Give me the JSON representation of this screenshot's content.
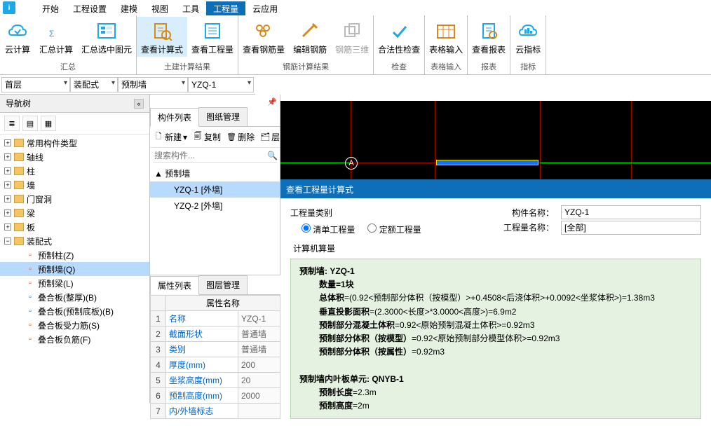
{
  "menubar": [
    "开始",
    "工程设置",
    "建模",
    "视图",
    "工具",
    "工程量",
    "云应用"
  ],
  "menubar_active_index": 5,
  "ribbon": {
    "groups": [
      {
        "label": "汇总",
        "items": [
          {
            "label": "云计算",
            "name": "cloud-calc"
          },
          {
            "label": "汇总计算",
            "name": "sum-calc"
          },
          {
            "label": "汇总选中图元",
            "name": "sum-selected"
          }
        ]
      },
      {
        "label": "土建计算结果",
        "items": [
          {
            "label": "查看计算式",
            "name": "view-formula",
            "active": true
          },
          {
            "label": "查看工程量",
            "name": "view-quantity"
          }
        ]
      },
      {
        "label": "钢筋计算结果",
        "items": [
          {
            "label": "查看钢筋量",
            "name": "view-rebar-qty"
          },
          {
            "label": "编辑钢筋",
            "name": "edit-rebar"
          },
          {
            "label": "钢筋三维",
            "name": "rebar-3d",
            "disabled": true
          }
        ]
      },
      {
        "label": "检查",
        "items": [
          {
            "label": "合法性检查",
            "name": "validity-check"
          }
        ]
      },
      {
        "label": "表格输入",
        "items": [
          {
            "label": "表格输入",
            "name": "table-input"
          }
        ]
      },
      {
        "label": "报表",
        "items": [
          {
            "label": "查看报表",
            "name": "view-report"
          }
        ]
      },
      {
        "label": "指标",
        "items": [
          {
            "label": "云指标",
            "name": "cloud-index"
          }
        ]
      }
    ]
  },
  "selectors": {
    "floor": "首层",
    "category": "装配式",
    "subcategory": "预制墙",
    "item": "YZQ-1"
  },
  "nav": {
    "title": "导航树",
    "items": [
      {
        "label": "常用构件类型",
        "level": 0
      },
      {
        "label": "轴线",
        "level": 0
      },
      {
        "label": "柱",
        "level": 0
      },
      {
        "label": "墙",
        "level": 0
      },
      {
        "label": "门窗洞",
        "level": 0
      },
      {
        "label": "梁",
        "level": 0
      },
      {
        "label": "板",
        "level": 0
      },
      {
        "label": "装配式",
        "level": 0,
        "expanded": true
      },
      {
        "label": "预制柱(Z)",
        "level": 1,
        "icon": "pillar",
        "color": "#d9534f"
      },
      {
        "label": "预制墙(Q)",
        "level": 1,
        "selected": true,
        "icon": "wall",
        "color": "#d9534f"
      },
      {
        "label": "预制梁(L)",
        "level": 1,
        "icon": "beam",
        "color": "#d9534f"
      },
      {
        "label": "叠合板(整厚)(B)",
        "level": 1,
        "icon": "slab",
        "color": "#1f6fb8"
      },
      {
        "label": "叠合板(预制底板)(B)",
        "level": 1,
        "icon": "slab",
        "color": "#1f6fb8"
      },
      {
        "label": "叠合板受力筋(S)",
        "level": 1,
        "icon": "rebar",
        "color": "#c05a10"
      },
      {
        "label": "叠合板负筋(F)",
        "level": 1,
        "icon": "rebar",
        "color": "#c05a10"
      }
    ]
  },
  "components": {
    "tabs": [
      "构件列表",
      "图纸管理"
    ],
    "toolbar": {
      "new": "新建",
      "copy": "复制",
      "delete": "删除",
      "layer_copy": "层间复制"
    },
    "search_placeholder": "搜索构件...",
    "parent": "预制墙",
    "items": [
      {
        "label": "YZQ-1 [外墙]",
        "selected": true
      },
      {
        "label": "YZQ-2 [外墙]"
      }
    ]
  },
  "props": {
    "tabs": [
      "属性列表",
      "图层管理"
    ],
    "header": "属性名称",
    "rows": [
      {
        "n": "1",
        "name": "名称",
        "val": "YZQ-1"
      },
      {
        "n": "2",
        "name": "截面形状",
        "val": "普通墙"
      },
      {
        "n": "3",
        "name": "类别",
        "val": "普通墙"
      },
      {
        "n": "4",
        "name": "厚度(mm)",
        "val": "200"
      },
      {
        "n": "5",
        "name": "坐浆高度(mm)",
        "val": "20"
      },
      {
        "n": "6",
        "name": "预制高度(mm)",
        "val": "2000"
      },
      {
        "n": "7",
        "name": "内/外墙标志",
        "val": ""
      }
    ]
  },
  "canvas": {
    "marker": "A"
  },
  "dlg": {
    "title": "查看工程量计算式",
    "category_label": "工程量类别",
    "radio1": "清单工程量",
    "radio2": "定额工程量",
    "name_label": "构件名称：",
    "name_val": "YZQ-1",
    "qty_label": "工程量名称：",
    "qty_val": "[全部]",
    "section": "计算机算量",
    "lines": [
      {
        "t": "预制墙: YZQ-1",
        "bold": true,
        "indent": 0
      },
      {
        "t": "数量=1块",
        "bold": true,
        "indent": 1
      },
      {
        "t": "总体积=(0.92<预制部分体积（按模型）>+0.4508<后浇体积>+0.0092<坐浆体积>)=1.38m3",
        "bold_prefix": "总体积",
        "indent": 1
      },
      {
        "t": "垂直投影面积=(2.3000<长度>*3.0000<高度>)=6.9m2",
        "bold_prefix": "垂直投影面积",
        "indent": 1
      },
      {
        "t": "预制部分混凝土体积=0.92<原始预制混凝土体积>=0.92m3",
        "bold_prefix": "预制部分混凝土体积",
        "indent": 1
      },
      {
        "t": "预制部分体积（按模型）=0.92<原始预制部分模型体积>=0.92m3",
        "bold_prefix": "预制部分体积（按模型）",
        "indent": 1
      },
      {
        "t": "预制部分体积（按属性）=0.92m3",
        "bold_prefix": "预制部分体积（按属性）",
        "indent": 1
      },
      {
        "t": "",
        "indent": 0
      },
      {
        "t": "预制墙内叶板单元: QNYB-1",
        "bold": true,
        "indent": 0
      },
      {
        "t": "预制长度=2.3m",
        "bold_prefix": "预制长度",
        "indent": 1
      },
      {
        "t": "预制高度=2m",
        "bold_prefix": "预制高度",
        "indent": 1
      }
    ]
  }
}
